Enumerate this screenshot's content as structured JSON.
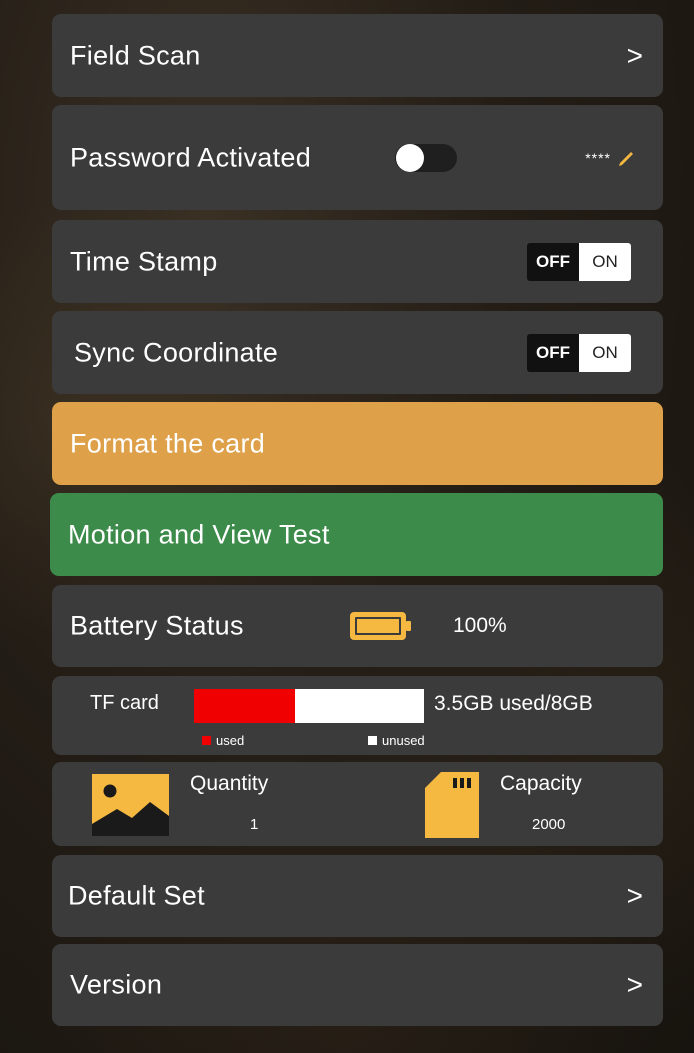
{
  "colors": {
    "card_bg": "#3b3b3b",
    "format_bg": "#dea14a",
    "motion_bg": "#3d8b4a",
    "accent_orange": "#f5b941",
    "used_red": "#f00000",
    "unused_white": "#ffffff"
  },
  "field_scan": {
    "label": "Field Scan",
    "chevron": ">"
  },
  "password": {
    "label": "Password Activated",
    "toggle_on": false,
    "mask": "****",
    "edit_icon": "pencil-icon"
  },
  "time_stamp": {
    "label": "Time Stamp",
    "off_label": "OFF",
    "on_label": "ON"
  },
  "sync_coordinate": {
    "label": "Sync Coordinate",
    "off_label": "OFF",
    "on_label": "ON"
  },
  "format_card": {
    "label": "Format the card"
  },
  "motion_test": {
    "label": "Motion and View Test"
  },
  "battery": {
    "label": "Battery Status",
    "icon": "battery-icon",
    "percent": "100%"
  },
  "tf_card": {
    "label": "TF card",
    "used_fraction": 0.4375,
    "usage_text": "3.5GB used/8GB",
    "legend_used": "used",
    "legend_unused": "unused"
  },
  "stats": {
    "quantity": {
      "icon": "image-icon",
      "title": "Quantity",
      "value": "1"
    },
    "capacity": {
      "icon": "sd-card-icon",
      "title": "Capacity",
      "value": "2000"
    }
  },
  "default_set": {
    "label": "Default Set",
    "chevron": ">"
  },
  "version": {
    "label": "Version",
    "chevron": ">"
  }
}
